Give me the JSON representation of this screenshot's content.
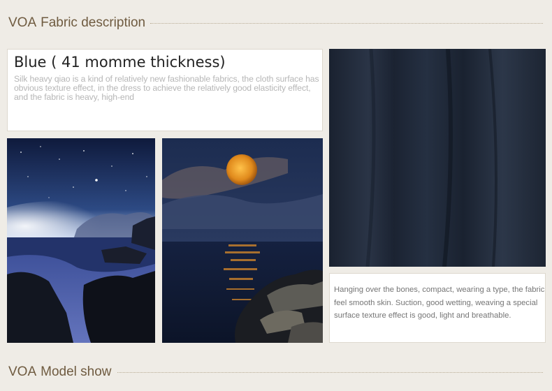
{
  "fabric_section": {
    "brand": "VOA",
    "title": "Fabric description"
  },
  "fabric_card": {
    "headline": "Blue ( 41 momme thickness)",
    "body": "Silk heavy qiao is a kind of relatively new fashionable fabrics, the cloth surface has obvious texture effect, in the dress to achieve the relatively good elasticity effect, and the fabric is heavy, high-end"
  },
  "fabric_note": {
    "body": "Hanging over the bones, compact, wearing a type, the fabric feel smooth skin. Suction, good wetting, weaving a special surface texture effect is good, light and breathable."
  },
  "model_section": {
    "brand": "VOA",
    "title": "Model show"
  },
  "colors": {
    "title_brown": "#6f5b40",
    "fabric_navy": "#1e2734",
    "background": "#efece6"
  }
}
